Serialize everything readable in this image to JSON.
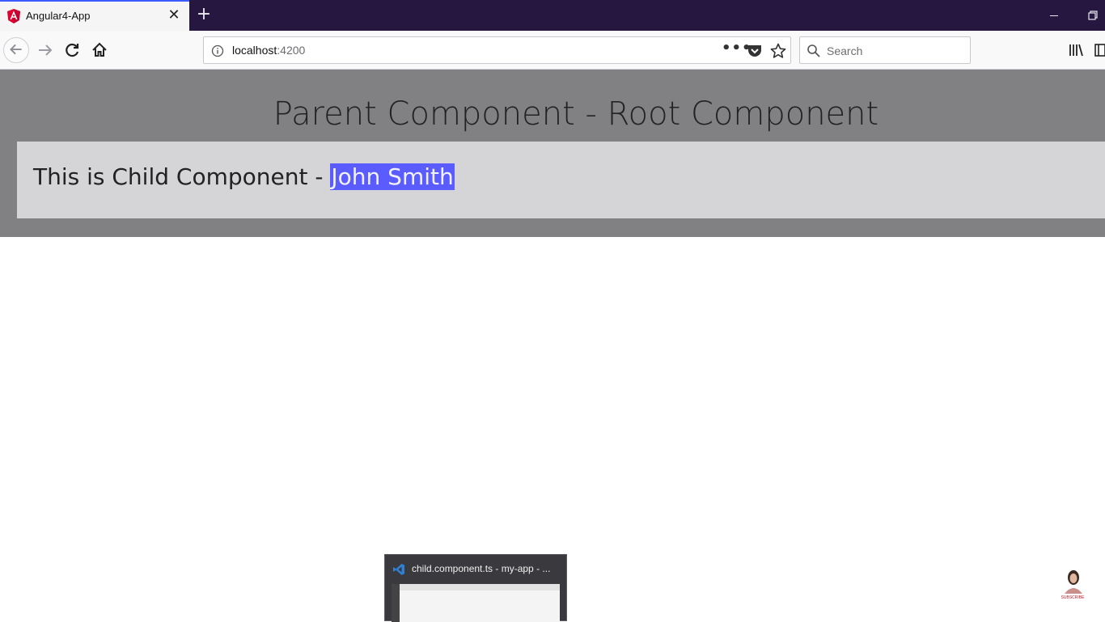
{
  "browser": {
    "tab": {
      "title": "Angular4-App",
      "favicon": "angular-icon"
    },
    "address": {
      "host": "localhost",
      "port": ":4200"
    },
    "search": {
      "placeholder": "Search"
    }
  },
  "page": {
    "parent_heading": "Parent Component - Root Component",
    "child_text": "This is Child Component - ",
    "child_name": "John Smith"
  },
  "taskbar_preview": {
    "title": "child.component.ts - my-app - ..."
  },
  "overlay": {
    "subscribe_label": "SUBSCRIBE"
  },
  "colors": {
    "parent_panel": "#818183",
    "child_panel": "#d5d4d6",
    "selection": "#5a5cff",
    "tabstrip": "#25173f"
  }
}
